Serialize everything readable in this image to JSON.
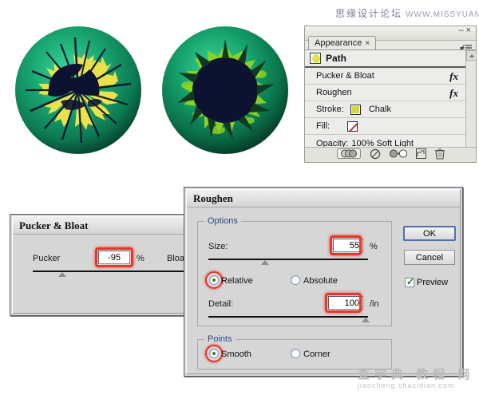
{
  "watermarks": {
    "top_cn": "思缘设计论坛",
    "top_url": "WWW.MISSYUAN.COM",
    "bottom_cn": "查字典 教程 网",
    "bottom_url": "jiaocheng.chazidian.com"
  },
  "artwork": {
    "left_eye_name": "pucker-bloat-eyeball",
    "right_eye_name": "roughen-eyeball",
    "iris_green_outer": "#0b6b4f",
    "iris_green_mid": "#16a06a",
    "iris_green_light": "#28c07c",
    "pupil_color": "#0d1230",
    "spike_yellow": "#e9e24a",
    "spike_lime": "#8fd41f"
  },
  "appearance_panel": {
    "tab_label": "Appearance",
    "tab_close": "×",
    "minimize": "–",
    "close": "×",
    "menu_icon": "panel-menu-icon",
    "rows": [
      {
        "label": "Path",
        "type": "header",
        "icon": "path-blob-icon"
      },
      {
        "label": "Pucker & Bloat",
        "type": "effect",
        "fx": "fx"
      },
      {
        "label": "Roughen",
        "type": "effect",
        "fx": "fx"
      },
      {
        "label": "Stroke:",
        "type": "stroke",
        "value": "Chalk",
        "swatch": "yellow-swatch"
      },
      {
        "label": "Fill:",
        "type": "fill",
        "value": "",
        "swatch": "none-swatch"
      },
      {
        "label": "Opacity:",
        "type": "opacity",
        "value": "100% Soft Light"
      }
    ],
    "footer_icons": [
      "new-art-has-basic-appearance-icon",
      "clear-appearance-icon",
      "reduce-to-basic-appearance-icon",
      "duplicate-item-icon",
      "delete-item-icon"
    ]
  },
  "pucker_dialog": {
    "title": "Pucker & Bloat",
    "left_label": "Pucker",
    "right_label": "Bloat",
    "value": "-95",
    "unit": "%"
  },
  "roughen_dialog": {
    "title": "Roughen",
    "options_group": "Options",
    "size_label": "Size:",
    "size_value": "55",
    "size_unit": "%",
    "relative_label": "Relative",
    "absolute_label": "Absolute",
    "relative_selected": true,
    "detail_label": "Detail:",
    "detail_value": "100",
    "detail_unit": "/in",
    "points_group": "Points",
    "smooth_label": "Smooth",
    "corner_label": "Corner",
    "smooth_selected": true,
    "ok_label": "OK",
    "cancel_label": "Cancel",
    "preview_label": "Preview",
    "preview_checked": true
  },
  "colors": {
    "highlight_red": "#e8342a",
    "group_label_blue": "#2b4b8c",
    "dialog_face": "#d6d6d6",
    "panel_face": "#ececea"
  }
}
